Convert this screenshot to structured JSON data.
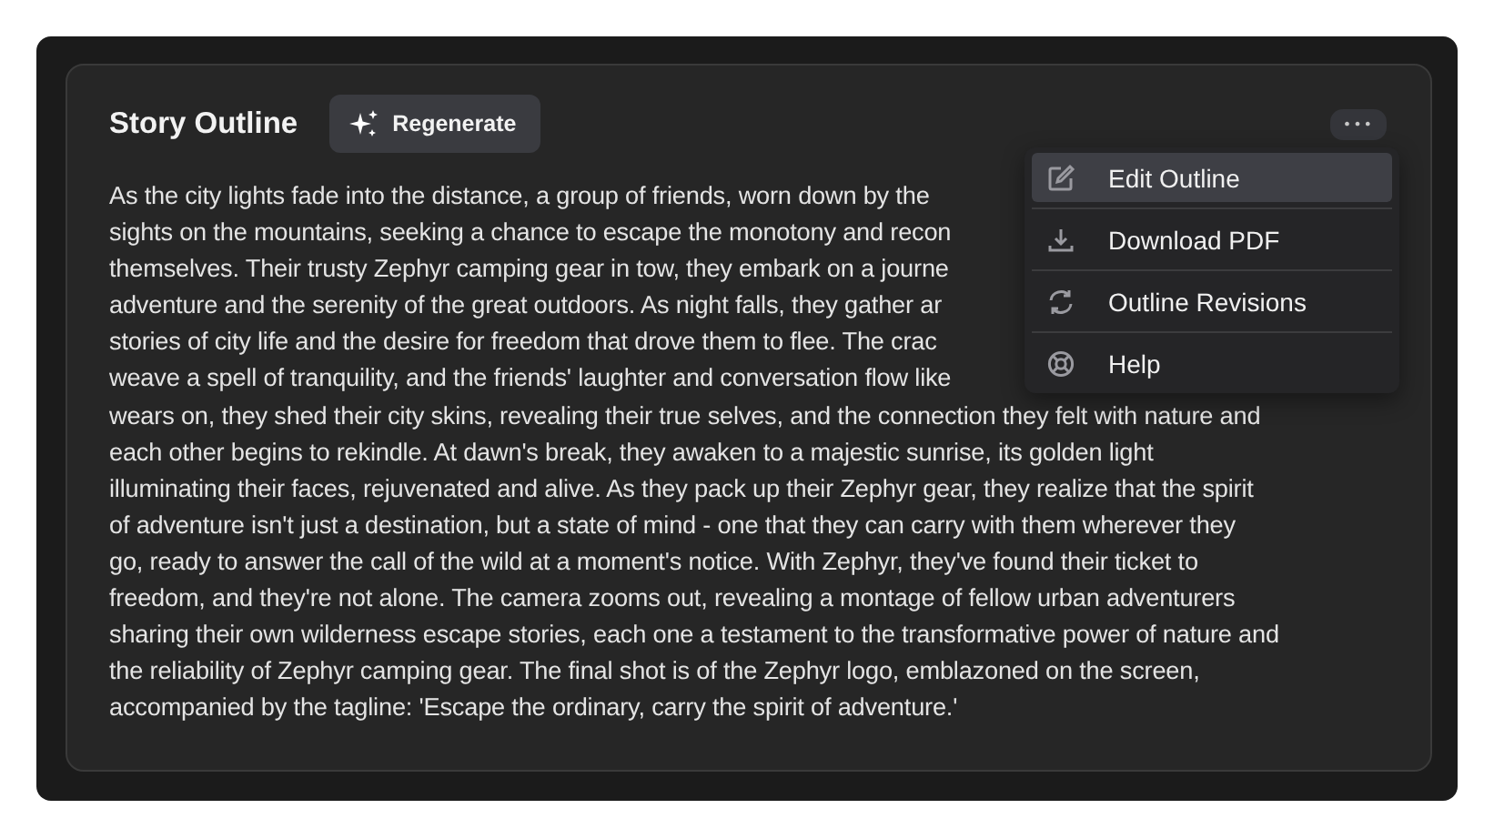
{
  "card": {
    "title": "Story Outline",
    "regenerate_button": "Regenerate",
    "more_button": "•••"
  },
  "paragraph_lines": [
    "As the city lights fade into the distance, a group of friends, worn down by the",
    "sights on the mountains, seeking a chance to escape the monotony and recon",
    "themselves. Their trusty Zephyr camping gear in tow, they embark on a journe",
    "adventure and the serenity of the great outdoors. As night falls, they gather ar",
    "stories of city life and the desire for freedom that drove them to flee. The crac",
    "weave a spell of tranquility, and the friends' laughter and conversation flow like",
    "wears on, they shed their city skins, revealing their true selves, and the connection they felt with nature and",
    "each other begins to rekindle. At dawn's break, they awaken to a majestic sunrise, its golden light",
    "illuminating their faces, rejuvenated and alive. As they pack up their Zephyr gear, they realize that the spirit",
    "of adventure isn't just a destination, but a state of mind - one that they can carry with them wherever they",
    "go, ready to answer the call of the wild at a moment's notice. With Zephyr, they've found their ticket to",
    "freedom, and they're not alone. The camera zooms out, revealing a montage of fellow urban adventurers",
    "sharing their own wilderness escape stories, each one a testament to the transformative power of nature and",
    "the reliability of Zephyr camping gear. The final shot is of the Zephyr logo, emblazoned on the screen,",
    "accompanied by the tagline: 'Escape the ordinary, carry the spirit of adventure.'"
  ],
  "menu": {
    "items": [
      {
        "kind": "edit",
        "label": "Edit Outline",
        "selected": true
      },
      {
        "kind": "download",
        "label": "Download PDF",
        "selected": false
      },
      {
        "kind": "revisions",
        "label": "Outline Revisions",
        "selected": false
      },
      {
        "kind": "help",
        "label": "Help",
        "selected": false
      }
    ]
  }
}
